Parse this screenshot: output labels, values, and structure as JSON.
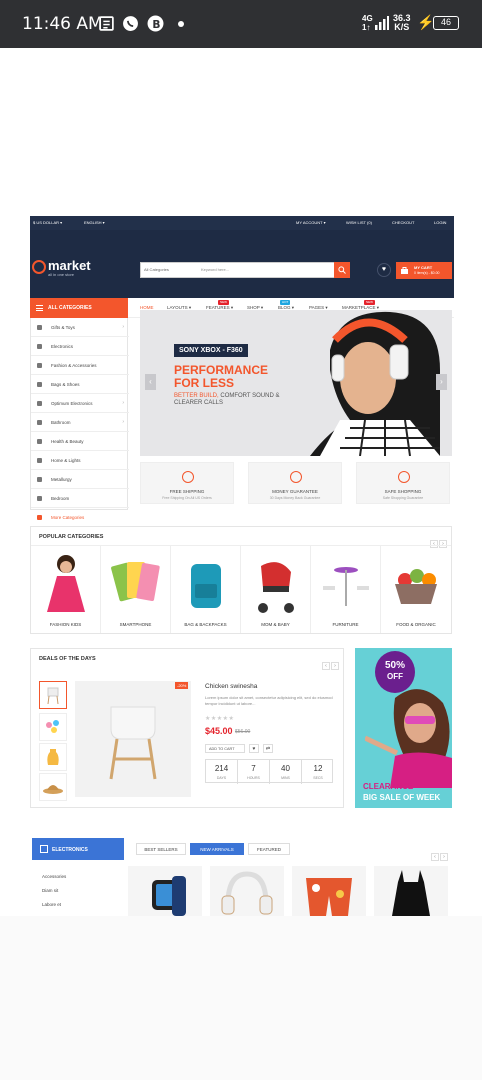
{
  "status_bar": {
    "time": "11:46 AM",
    "network": "4G",
    "network_sub": "1↑",
    "speed_value": "36.3",
    "speed_unit": "K/S",
    "battery": "46"
  },
  "topbar": {
    "currency": "$ US DOLLAR ▾",
    "language": "ENGLISH ▾",
    "my_account": "MY ACCOUNT ▾",
    "wish_list": "WISH LIST (0)",
    "checkout": "CHECKOUT",
    "login": "LOGIN"
  },
  "header": {
    "logo": "market",
    "logo_sub": "all in one store",
    "search_category": "All Categories",
    "search_placeholder": "Keyword here...",
    "cart_title": "MY CART",
    "cart_count": "0 item(s) - $0.00"
  },
  "nav": {
    "all_categories": "ALL CATEGORIES",
    "items": [
      "HOME",
      "LAYOUTS ▾",
      "FEATURES ▾",
      "SHOP ▾",
      "BLOG ▾",
      "PAGES ▾",
      "MARKETPLACE ▾"
    ],
    "badge_new": "NEW",
    "badge_hot": "HOT"
  },
  "sidebar": [
    {
      "label": "Gifts & Toys",
      "arrow": "›"
    },
    {
      "label": "Electronics",
      "arrow": ""
    },
    {
      "label": "Fashion & Accessories",
      "arrow": ""
    },
    {
      "label": "Bags & Shoes",
      "arrow": ""
    },
    {
      "label": "Optimum Electronics",
      "arrow": "›"
    },
    {
      "label": "Bathroom",
      "arrow": "›"
    },
    {
      "label": "Health & Beauty",
      "arrow": ""
    },
    {
      "label": "Home & Lights",
      "arrow": ""
    },
    {
      "label": "Metallurgy",
      "arrow": ""
    },
    {
      "label": "Bedroom",
      "arrow": ""
    },
    {
      "label": "More Categories",
      "arrow": ""
    }
  ],
  "slider": {
    "tag": "SONY XBOX - F360",
    "headline1": "PERFORMANCE",
    "headline2": "FOR LESS",
    "sub_highlight": "BETTER BUILD,",
    "sub_rest": " COMFORT SOUND & CLEARER CALLS",
    "prev": "‹",
    "next": "›"
  },
  "features": [
    {
      "title": "FREE SHIPPING",
      "sub": "Free Shipping On All US Orders"
    },
    {
      "title": "MONEY GUARANTEE",
      "sub": "30 Days Money Back Guarantee"
    },
    {
      "title": "SAFE SHOPPING",
      "sub": "Safe Shopping Guarantee"
    }
  ],
  "popular": {
    "title": "POPULAR CATEGORIES",
    "items": [
      "FASHION KIDS",
      "SMARTPHONE",
      "BAG & BACKPACKS",
      "MOM & BABY",
      "FURNITURE",
      "FOOD & ORGANIC"
    ]
  },
  "deals": {
    "title": "DEALS OF THE DAYS",
    "sale": "-20%",
    "product_name": "Chicken swinesha",
    "desc": "Lorem ipsum dolor sit amet, consectetur adipisicing elit, sed do eiusmod tempor incididunt ut labore...",
    "stars": "★★★★★",
    "price": "$45.00",
    "old_price": "$56.00",
    "add_to_cart": "ADD TO CART",
    "wishlist": "♥",
    "compare": "⇄",
    "countdown": [
      {
        "n": "214",
        "u": "DAYS"
      },
      {
        "n": "7",
        "u": "HOURS"
      },
      {
        "n": "40",
        "u": "MINS"
      },
      {
        "n": "12",
        "u": "SECS"
      }
    ]
  },
  "banner": {
    "pct": "50%",
    "off": "OFF",
    "line1": "CLEARANCE",
    "line2": "BIG SALE OF WEEK"
  },
  "electronics": {
    "title": "ELECTRONICS",
    "tabs": [
      "BEST SELLERS",
      "NEW ARRIVALS",
      "FEATURED"
    ],
    "list": [
      "Accessories",
      "Diam sit",
      "Labore et"
    ]
  },
  "arrows": {
    "left": "‹",
    "right": "›"
  }
}
